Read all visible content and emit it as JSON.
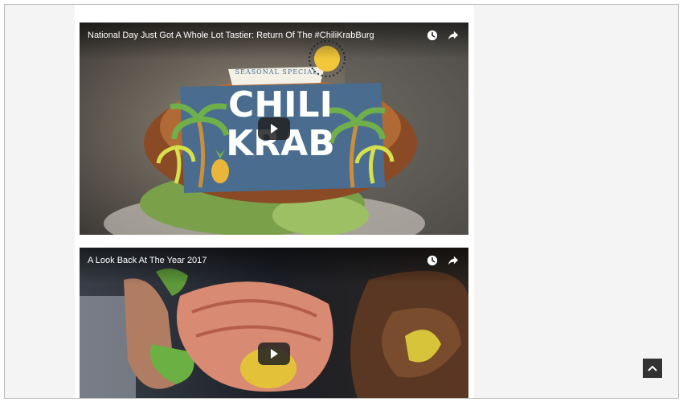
{
  "videos": [
    {
      "title": "National Day Just Got A Whole Lot Tastier: Return Of The #ChiliKrabBurg",
      "thumbnail_banner": "SEASONAL SPECIAL",
      "thumbnail_title_line1": "CHILI",
      "thumbnail_title_line2": "KRAB",
      "icons": [
        "watch-later-icon",
        "share-icon"
      ]
    },
    {
      "title": "A Look Back At The Year 2017",
      "icons": [
        "watch-later-icon",
        "share-icon"
      ]
    }
  ],
  "colors": {
    "page_background": "#f4f4f4",
    "content_background": "#ffffff",
    "badge_blue": "#4a6d8f",
    "back_to_top": "#333333"
  }
}
